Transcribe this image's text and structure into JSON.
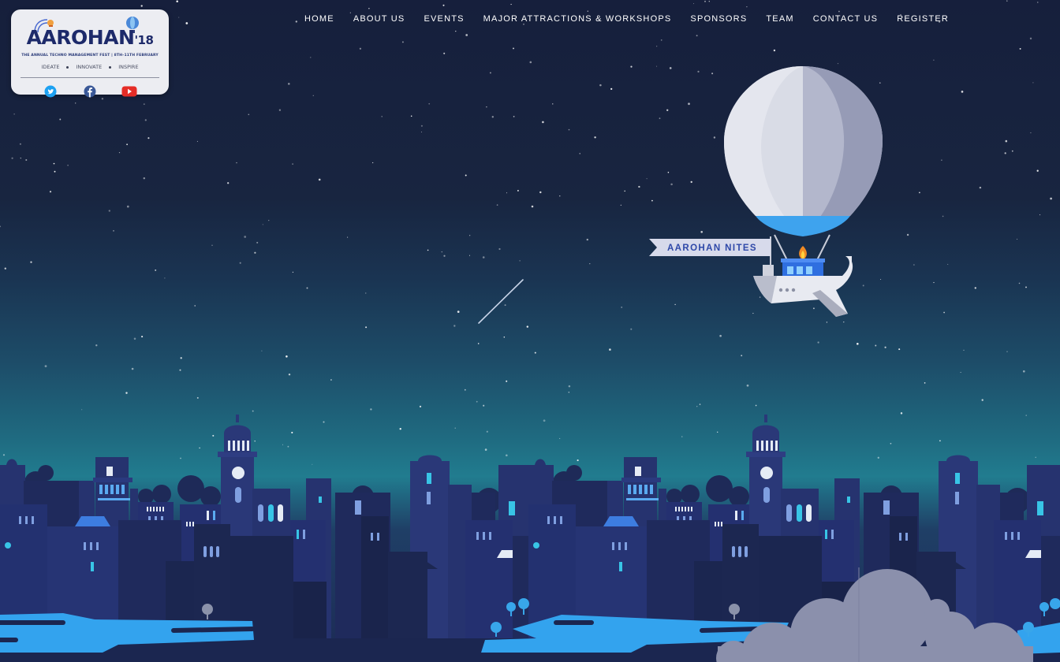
{
  "colors": {
    "sky_top": "#161f3c",
    "sky_mid": "#1f6a80",
    "city_dark": "#1b2650",
    "city_mid": "#243273",
    "window_cyan": "#38c5e6",
    "water_blue": "#33a3ee",
    "balloon_white": "#d8dbe5",
    "balloon_shade": "#8f95b0",
    "twitter_blue": "#1da1f2",
    "facebook_blue": "#3b5998",
    "youtube_red": "#e52d27"
  },
  "logo": {
    "title": "AAROHAN",
    "year": "'18",
    "subtitle": "THE ANNUAL TECHNO MANAGEMENT FEST | 8TH–11TH FEBRUARY",
    "tags": [
      "IDEATE",
      "INNOVATE",
      "INSPIRE"
    ],
    "icons": [
      "satellite-icon",
      "hot-air-balloon-icon"
    ]
  },
  "socials": [
    {
      "name": "twitter-icon",
      "label": "Twitter"
    },
    {
      "name": "facebook-icon",
      "label": "Facebook"
    },
    {
      "name": "youtube-icon",
      "label": "YouTube"
    }
  ],
  "nav": {
    "items": [
      "HOME",
      "ABOUT US",
      "EVENTS",
      "MAJOR ATTRACTIONS & WORKSHOPS",
      "SPONSORS",
      "TEAM",
      "CONTACT US",
      "REGISTER"
    ]
  },
  "hero": {
    "banner_text": "AAROHAN NITES"
  }
}
